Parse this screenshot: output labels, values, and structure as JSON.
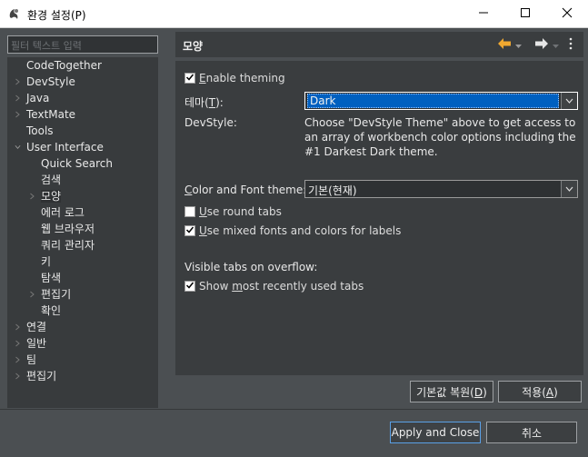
{
  "window": {
    "title": "환경 설정(P)"
  },
  "filter": {
    "placeholder": "필터 텍스트 입력"
  },
  "tree": {
    "items": [
      {
        "label": "CodeTogether"
      },
      {
        "label": "DevStyle"
      },
      {
        "label": "Java"
      },
      {
        "label": "TextMate"
      },
      {
        "label": "Tools"
      },
      {
        "label": "User Interface"
      },
      {
        "label": "Quick Search"
      },
      {
        "label": "검색"
      },
      {
        "label": "모양"
      },
      {
        "label": "에러 로그"
      },
      {
        "label": "웹 브라우저"
      },
      {
        "label": "쿼리 관리자"
      },
      {
        "label": "키"
      },
      {
        "label": "탐색"
      },
      {
        "label": "편집기"
      },
      {
        "label": "확인"
      },
      {
        "label": "연결"
      },
      {
        "label": "일반"
      },
      {
        "label": "팀"
      },
      {
        "label": "편집기"
      }
    ]
  },
  "header": {
    "title": "모양"
  },
  "settings": {
    "enable_theming": {
      "prefix": "",
      "mnemonic": "E",
      "rest": "nable theming",
      "checked": true
    },
    "theme_label": {
      "prefix": "테마(",
      "mnemonic": "T",
      "rest": "):"
    },
    "theme_value": "Dark",
    "devstyle_label": "DevStyle:",
    "devstyle_desc": "Choose \"DevStyle Theme\" above to get access to an array of workbench color options including the #1 Darkest Dark theme.",
    "color_font_label": {
      "prefix": "",
      "mnemonic": "C",
      "rest": "olor and Font theme:"
    },
    "color_font_value": "기본(현재)",
    "round_tabs": {
      "prefix": "",
      "mnemonic": "U",
      "rest": "se round tabs",
      "checked": false
    },
    "mixed_fonts": {
      "prefix": "",
      "mnemonic": "U",
      "rest": "se mixed fonts and colors for labels",
      "checked": true
    },
    "visible_tabs_label": "Visible tabs on overflow:",
    "show_recent": {
      "prefix": "Show ",
      "mnemonic": "m",
      "rest": "ost recently used tabs",
      "checked": true
    }
  },
  "buttons": {
    "restore_defaults": {
      "prefix": "기본값 복원(",
      "mnemonic": "D",
      "rest": ")"
    },
    "apply": {
      "prefix": "적용(",
      "mnemonic": "A",
      "rest": ")"
    },
    "apply_close": "Apply and Close",
    "cancel": "취소"
  },
  "colors": {
    "background": "#4b4f52",
    "panel": "#3a3d3f",
    "tree_bg": "#383b3d",
    "selection": "#0060c0",
    "nav_arrow_active": "#f0a830",
    "titlebar": "#ffffff"
  },
  "icons": {
    "app": "eclipse-preferences-icon",
    "minimize": "minimize-icon",
    "maximize": "maximize-icon",
    "close": "close-icon",
    "back": "back-arrow-icon",
    "forward": "forward-arrow-icon",
    "menu": "vertical-ellipsis-icon",
    "expand": "chevron-right-icon",
    "collapse": "chevron-down-icon",
    "dropdown": "dropdown-arrow-icon",
    "check": "check-icon"
  }
}
